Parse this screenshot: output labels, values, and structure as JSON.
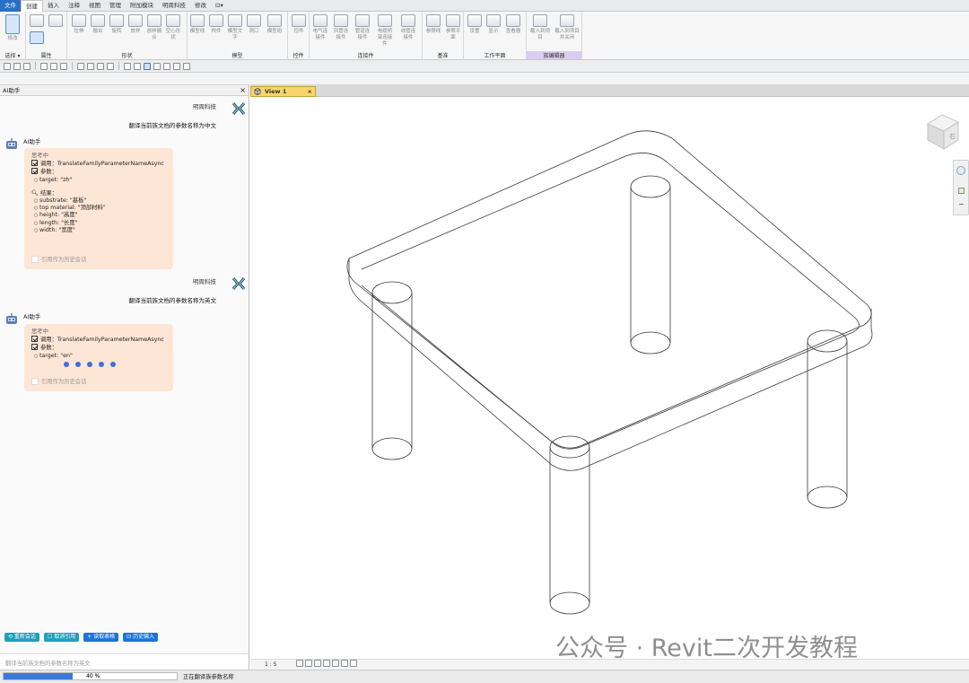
{
  "ribbon": {
    "tabs": [
      "文件",
      "创建",
      "插入",
      "注释",
      "视图",
      "管理",
      "附加模块",
      "明周科技",
      "修改",
      "⊡▾"
    ],
    "active_tab": "创建",
    "buttons": [
      {
        "label": "修改"
      },
      {
        "label": "拉伸"
      },
      {
        "label": "融合"
      },
      {
        "label": "旋转"
      },
      {
        "label": "放样"
      },
      {
        "label": "放样融合"
      },
      {
        "label": "空心形状"
      },
      {
        "label": "模型线"
      },
      {
        "label": "构件"
      },
      {
        "label": "模型文字"
      },
      {
        "label": "洞口"
      },
      {
        "label": "模型组"
      },
      {
        "label": "控件"
      },
      {
        "label": "电气连接件"
      },
      {
        "label": "风管连接件"
      },
      {
        "label": "管道连接件"
      },
      {
        "label": "电缆桥架连接件"
      },
      {
        "label": "线管连接件"
      },
      {
        "label": "参照线"
      },
      {
        "label": "参照平面"
      },
      {
        "label": "设置"
      },
      {
        "label": "显示"
      },
      {
        "label": "查看器"
      },
      {
        "label": "载入到项目"
      },
      {
        "label": "载入到项目并关闭"
      }
    ],
    "groups": [
      "选择 ▾",
      "属性",
      "形状",
      "模型",
      "控件",
      "连接件",
      "基准",
      "工作平面",
      "族编辑器"
    ]
  },
  "ai_panel": {
    "title": "AI助手",
    "close": "×",
    "messages": [
      {
        "user_name": "明周科技",
        "user_text": "翻译当前族文档的参数名称为中文",
        "bot_name": "AI助手",
        "thinking": "思考中",
        "call": "调用：TranslateFamilyParameterNameAsync",
        "params_label": "参数：",
        "params": [
          "target: \"zh\""
        ],
        "result_label": "结果：",
        "results": [
          "substrate: \"基板\"",
          "top material: \"顶部材料\"",
          "height: \"高度\"",
          "length: \"长度\"",
          "width: \"宽度\""
        ],
        "quote": "引用作为历史会话"
      },
      {
        "user_name": "明周科技",
        "user_text": "翻译当前族文档的参数名称为英文",
        "bot_name": "AI助手",
        "thinking": "思考中",
        "call": "调用：TranslateFamilyParameterNameAsync",
        "params_label": "参数：",
        "params": [
          "target: \"en\""
        ],
        "quote": "引用作为历史会话"
      }
    ],
    "buttons": [
      "⟲ 重新会话",
      "☐ 取消引用",
      "+ 读取表格",
      "⊡ 历史输入"
    ],
    "input_text": "翻译当前族文档的参数名称为英文"
  },
  "view": {
    "tab_label": "View 1",
    "tab_close": "×",
    "scale": "1 : 5",
    "viewcube_face": "右"
  },
  "status": {
    "progress_percent": 40,
    "progress_text": "40 %",
    "message": "正在翻译族参数名称"
  },
  "watermark": "公众号 · Revit二次开发教程",
  "colors": {
    "accent": "#2a6fc5",
    "bubble": "#fde6d6",
    "active_view_tab": "#f7d56a",
    "progress": "#3b78d8"
  }
}
